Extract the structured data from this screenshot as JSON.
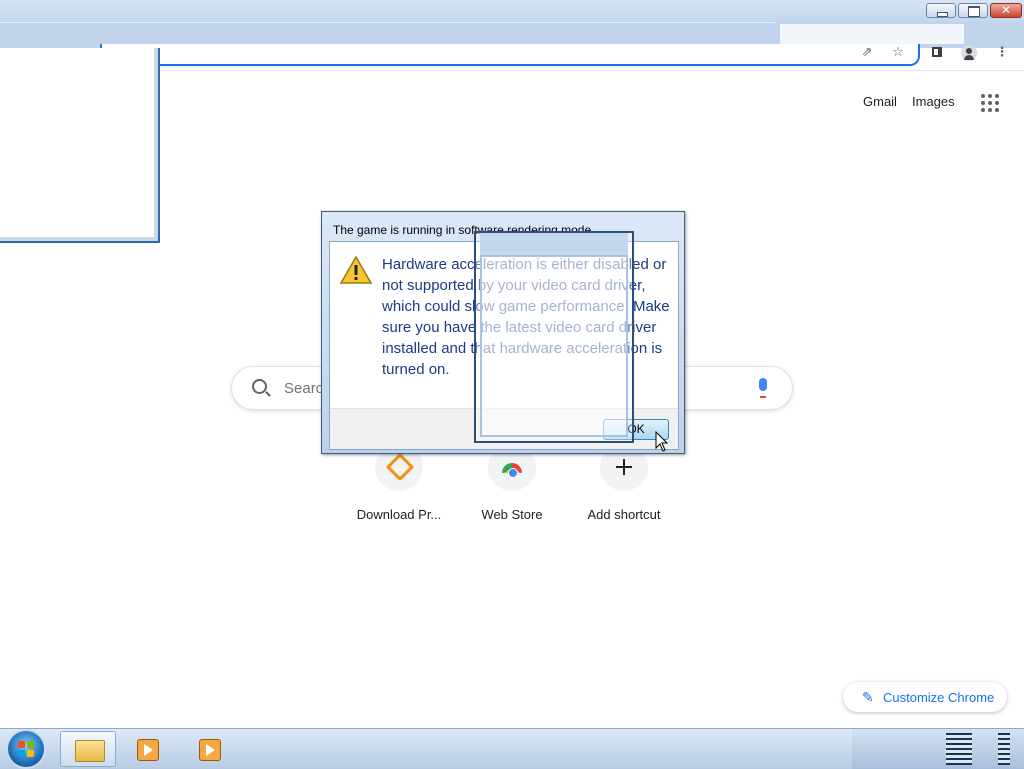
{
  "window": {
    "controls": [
      "minimize-icon",
      "restore-icon",
      "close-icon"
    ]
  },
  "toolbar": {
    "icons": [
      "share-icon",
      "bookmark-star-icon",
      "side-panel-icon",
      "profile-icon",
      "menu-kebab-icon"
    ]
  },
  "ntp": {
    "gmail_label": "Gmail",
    "images_label": "Images",
    "search_placeholder": "Search",
    "shortcuts": [
      {
        "label": "Download Pr...",
        "icon": "download-progress-icon"
      },
      {
        "label": "Web Store",
        "icon": "web-store-icon"
      },
      {
        "label": "Add shortcut",
        "icon": "plus-icon"
      }
    ],
    "customize_label": "Customize Chrome"
  },
  "dialog": {
    "title": "The game is running in software rendering mode",
    "message": "Hardware acceleration is either disabled or not supported by your video card driver, which could slow game performance. Make sure you have the latest video card driver installed and that hardware acceleration is turned on.",
    "ok_label": "OK",
    "icon": "warning-icon"
  },
  "taskbar": {
    "items": [
      "start-orb",
      "file-explorer-icon",
      "media-player-icon",
      "media-player-icon"
    ]
  },
  "colors": {
    "accent": "#1a73e8",
    "dialog_text": "#1c3a8a",
    "taskbar": "#b7cbe4"
  }
}
